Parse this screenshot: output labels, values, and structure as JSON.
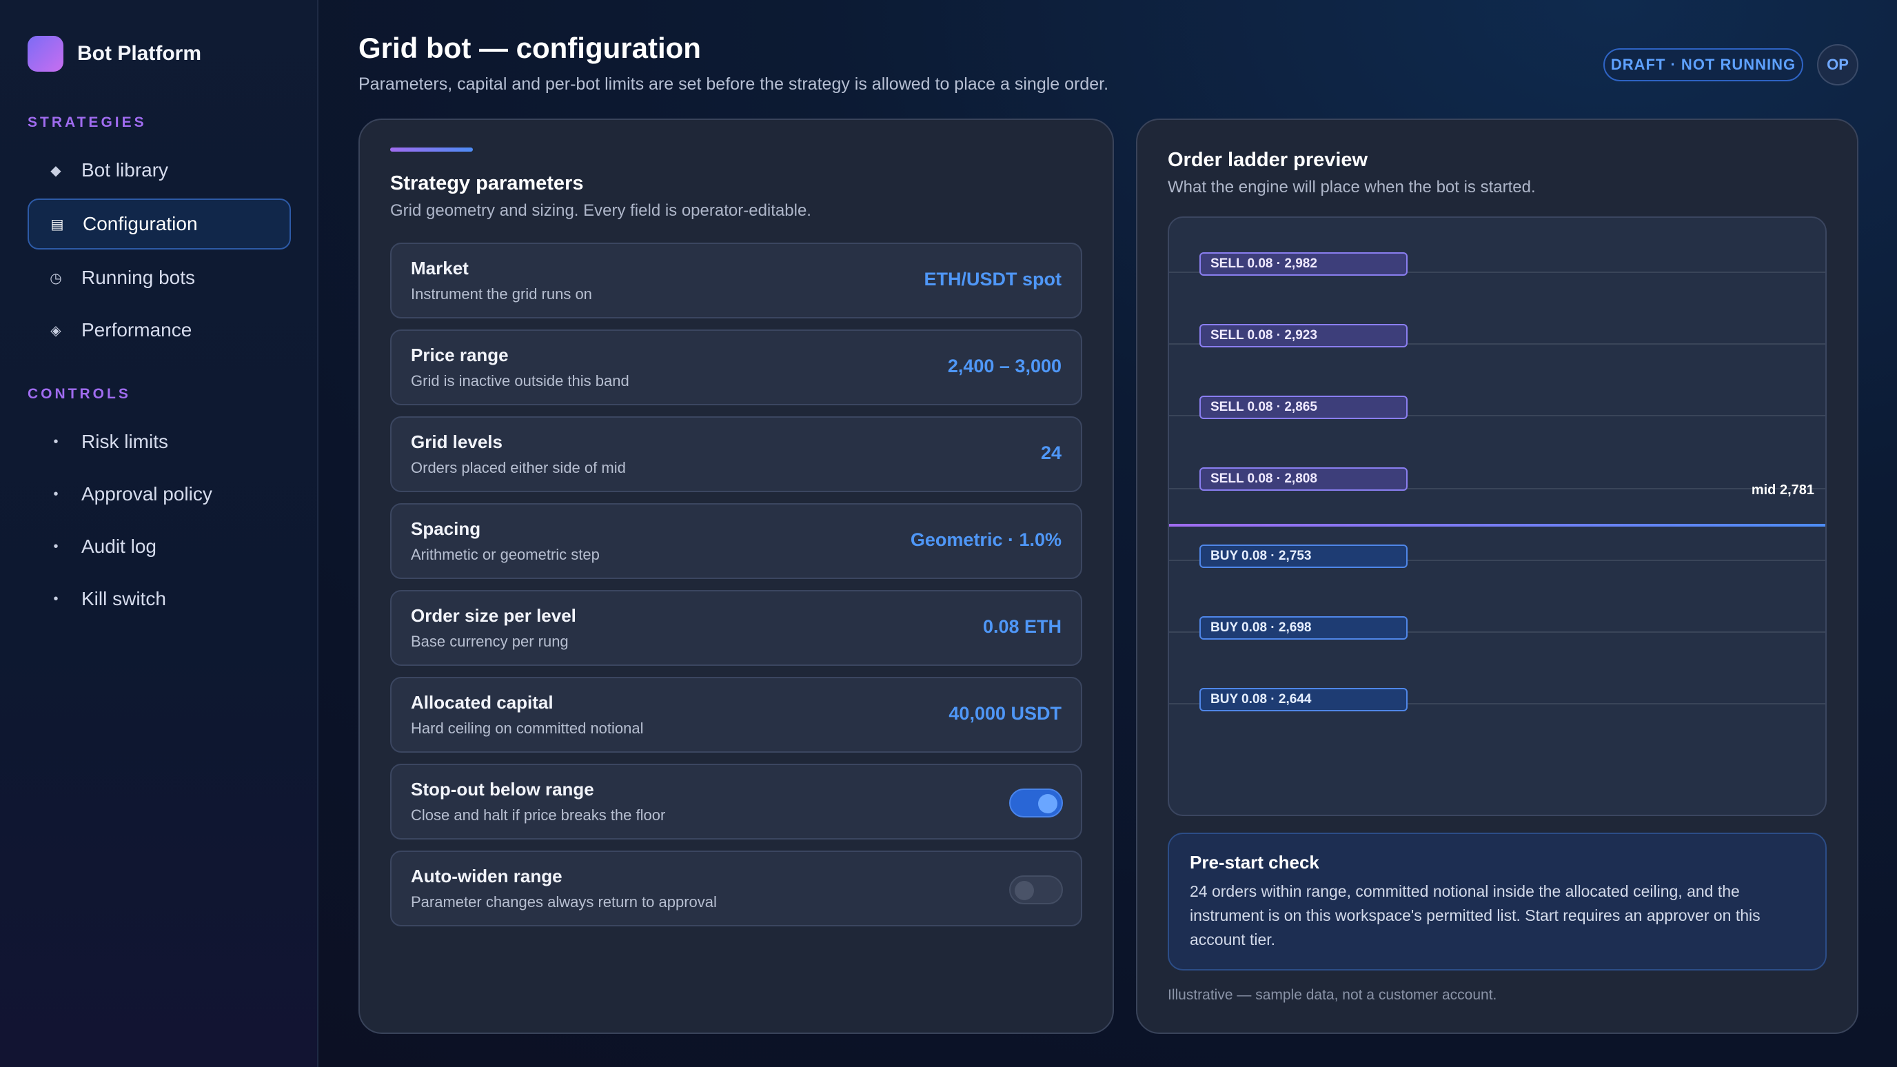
{
  "app": {
    "name": "Bot Platform"
  },
  "sidebar": {
    "sections": [
      {
        "label": "STRATEGIES",
        "items": [
          {
            "label": "Bot library",
            "icon": "diamond-icon",
            "active": false
          },
          {
            "label": "Configuration",
            "icon": "list-icon",
            "active": true
          },
          {
            "label": "Running bots",
            "icon": "clock-icon",
            "active": false
          },
          {
            "label": "Performance",
            "icon": "diamond-outline-icon",
            "active": false
          }
        ]
      },
      {
        "label": "CONTROLS",
        "items": [
          {
            "label": "Risk limits",
            "icon": "dot-icon"
          },
          {
            "label": "Approval policy",
            "icon": "dot-icon"
          },
          {
            "label": "Audit log",
            "icon": "dot-icon"
          },
          {
            "label": "Kill switch",
            "icon": "dot-icon"
          }
        ]
      }
    ]
  },
  "header": {
    "title": "Grid bot — configuration",
    "subtitle": "Parameters, capital and per-bot limits are set before the strategy is allowed to place a single order.",
    "status": "DRAFT · NOT RUNNING",
    "avatar": "OP"
  },
  "params": {
    "title": "Strategy parameters",
    "subtitle": "Grid geometry and sizing. Every field is operator-editable.",
    "rows": [
      {
        "label": "Market",
        "desc": "Instrument the grid runs on",
        "value": "ETH/USDT spot"
      },
      {
        "label": "Price range",
        "desc": "Grid is inactive outside this band",
        "value": "2,400 – 3,000"
      },
      {
        "label": "Grid levels",
        "desc": "Orders placed either side of mid",
        "value": "24"
      },
      {
        "label": "Spacing",
        "desc": "Arithmetic or geometric step",
        "value": "Geometric · 1.0%"
      },
      {
        "label": "Order size per level",
        "desc": "Base currency per rung",
        "value": "0.08 ETH"
      },
      {
        "label": "Allocated capital",
        "desc": "Hard ceiling on committed notional",
        "value": "40,000 USDT"
      }
    ],
    "toggles": [
      {
        "label": "Stop-out below range",
        "desc": "Close and halt if price breaks the floor",
        "on": true
      },
      {
        "label": "Auto-widen range",
        "desc": "Parameter changes always return to approval",
        "on": false
      }
    ]
  },
  "ladder": {
    "title": "Order ladder preview",
    "subtitle": "What the engine will place when the bot is started.",
    "sell": [
      "SELL 0.08 · 2,982",
      "SELL 0.08 · 2,923",
      "SELL 0.08 · 2,865",
      "SELL 0.08 · 2,808"
    ],
    "mid": "mid 2,781",
    "buy": [
      "BUY 0.08 · 2,753",
      "BUY 0.08 · 2,698",
      "BUY 0.08 · 2,644"
    ],
    "colors": {
      "sell": "#8a7ef0",
      "buy": "#4f86e8"
    }
  },
  "precheck": {
    "title": "Pre-start check",
    "body": "24 orders within range, committed notional inside the allocated ceiling, and the instrument is on this workspace's permitted list. Start requires an approver on this account tier."
  },
  "footnote": "Illustrative — sample data, not a customer account."
}
